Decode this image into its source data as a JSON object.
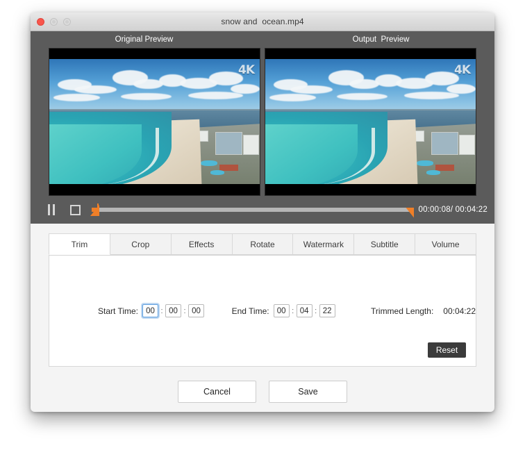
{
  "window": {
    "title": "snow and  ocean.mp4",
    "traffic_lights": [
      {
        "name": "close",
        "color": "#f9564c"
      },
      {
        "name": "minimize",
        "color": "#dcdcdc"
      },
      {
        "name": "zoom",
        "color": "#dcdcdc"
      }
    ]
  },
  "preview": {
    "original_label": "Original Preview",
    "output_label": "Output  Preview",
    "watermark": "4K"
  },
  "transport": {
    "pause_icon": "pause-icon",
    "stop_icon": "stop-icon",
    "current_time": "00:00:08",
    "separator": "/ ",
    "total_time": "00:04:22",
    "readout": "00:00:08/ 00:04:22",
    "trim_start_pct": 2,
    "trim_end_pct": 100,
    "accent_color": "#f07f28"
  },
  "tabs": [
    {
      "label": "Trim",
      "active": true
    },
    {
      "label": "Crop",
      "active": false
    },
    {
      "label": "Effects",
      "active": false
    },
    {
      "label": "Rotate",
      "active": false
    },
    {
      "label": "Watermark",
      "active": false
    },
    {
      "label": "Subtitle",
      "active": false
    },
    {
      "label": "Volume",
      "active": false
    }
  ],
  "trim_panel": {
    "start_label": "Start Time:",
    "start_hh": "00",
    "start_mm": "00",
    "start_ss": "00",
    "end_label": "End Time:",
    "end_hh": "00",
    "end_mm": "04",
    "end_ss": "22",
    "length_label": "Trimmed Length:",
    "length_value": "00:04:22",
    "colon": ":",
    "reset_label": "Reset"
  },
  "footer": {
    "cancel_label": "Cancel",
    "save_label": "Save"
  }
}
